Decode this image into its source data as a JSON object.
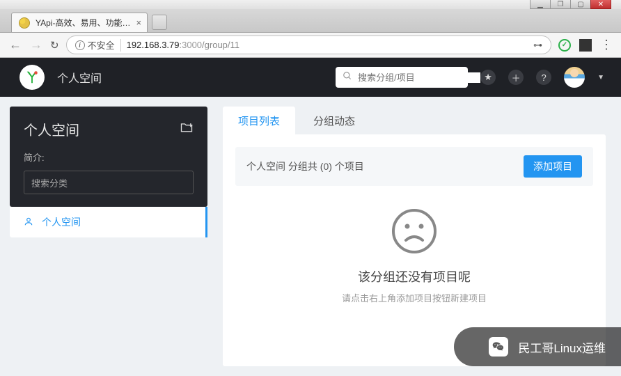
{
  "window": {
    "tab_title": "YApi-高效、易用、功能…",
    "security_label": "不安全",
    "url_host": "192.168.3.79",
    "url_port": ":3000",
    "url_path": "/group/11"
  },
  "header": {
    "app_title": "个人空间",
    "search_placeholder": "搜索分组/项目"
  },
  "sidebar": {
    "title": "个人空间",
    "brief_label": "简介:",
    "search_placeholder": "搜索分类",
    "items": [
      {
        "label": "个人空间"
      }
    ]
  },
  "tabs": [
    {
      "label": "项目列表",
      "active": true
    },
    {
      "label": "分组动态",
      "active": false
    }
  ],
  "panel": {
    "count_text": "个人空间 分组共 (0) 个项目",
    "add_button": "添加项目",
    "empty_title": "该分组还没有项目呢",
    "empty_sub": "请点击右上角添加项目按钮新建项目"
  },
  "watermark": "民工哥Linux运维"
}
